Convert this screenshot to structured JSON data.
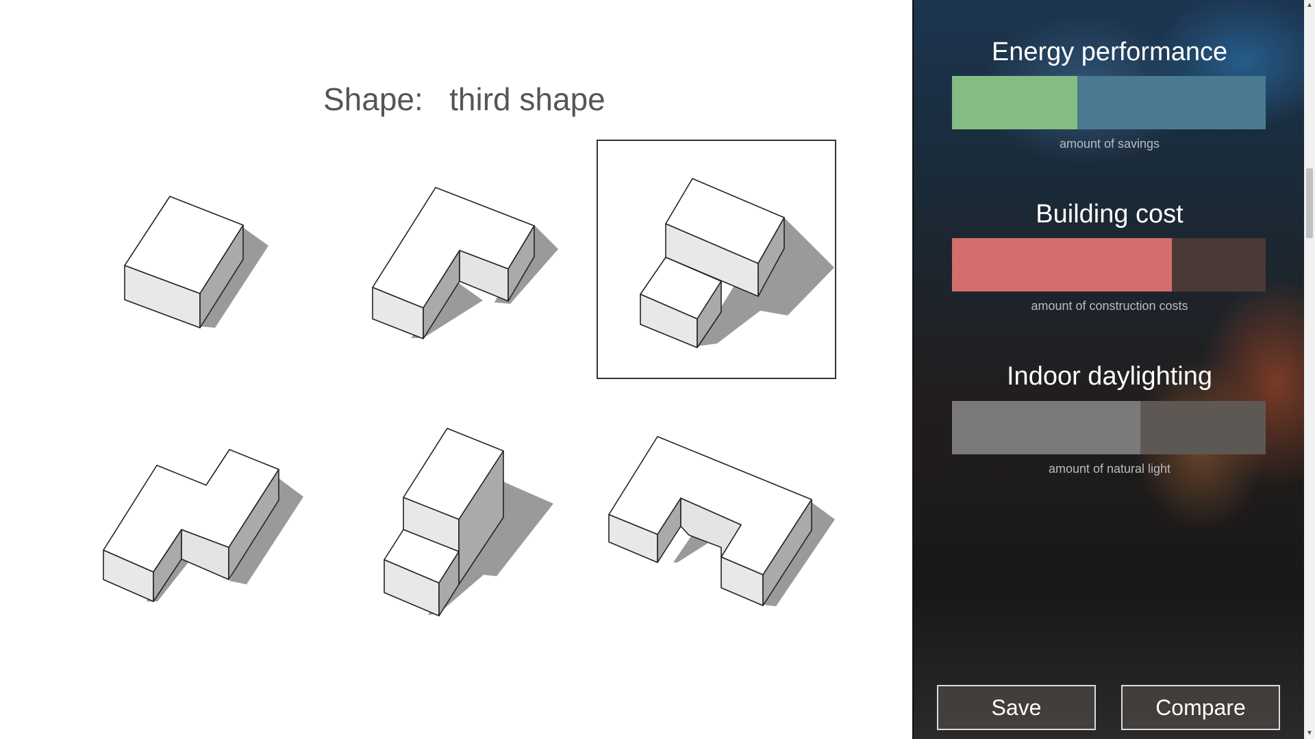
{
  "shape_label": "Shape:",
  "shape_value": "third shape",
  "shapes": [
    {
      "name": "first shape",
      "selected": false
    },
    {
      "name": "second shape",
      "selected": false
    },
    {
      "name": "third shape",
      "selected": true
    },
    {
      "name": "fourth shape",
      "selected": false
    },
    {
      "name": "fifth shape",
      "selected": false
    },
    {
      "name": "sixth shape",
      "selected": false
    }
  ],
  "metrics": [
    {
      "title": "Energy performance",
      "subtitle": "amount of savings",
      "fraction": 0.4,
      "color": "#84bd84",
      "track_color": "#4a7a92"
    },
    {
      "title": "Building cost",
      "subtitle": "amount of construction costs",
      "fraction": 0.7,
      "color": "#d46e6c",
      "track_color": "#4a3a36"
    },
    {
      "title": "Indoor daylighting",
      "subtitle": "amount of natural light",
      "fraction": 0.6,
      "color": "#7a7a7a",
      "track_color": "#5e5854"
    }
  ],
  "buttons": {
    "save": "Save",
    "compare": "Compare"
  },
  "scrollbar": {
    "up": "▲",
    "down": "▼"
  }
}
